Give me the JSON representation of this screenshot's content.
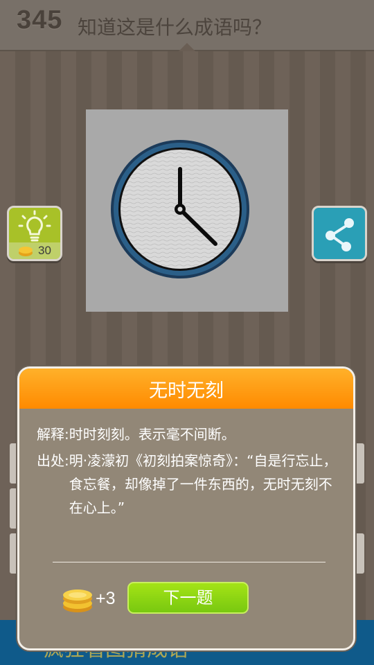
{
  "header": {
    "level": "345",
    "question": "知道这是什么成语吗？"
  },
  "hint_button": {
    "cost": "30",
    "icon": "lightbulb-icon",
    "color": "#a8c128"
  },
  "share_button": {
    "icon": "share-icon",
    "color": "#2a9fb6"
  },
  "puzzle_image": {
    "description_icon": "clock-icon"
  },
  "bottom_banner": {
    "text": "疯狂看图猜成语"
  },
  "dialog": {
    "title": "无时无刻",
    "explanation_label": "解释:",
    "explanation_text": "时时刻刻。表示毫不间断。",
    "source_label": "出处:",
    "source_text": "明·凌濛初《初刻拍案惊奇》：“自是行忘止，食忘餐，却像掉了一件东西的，无时无刻不在心上。”",
    "reward": "+3",
    "next_button": "下一题",
    "header_color": "#ff8a00",
    "button_color": "#8fd614"
  }
}
